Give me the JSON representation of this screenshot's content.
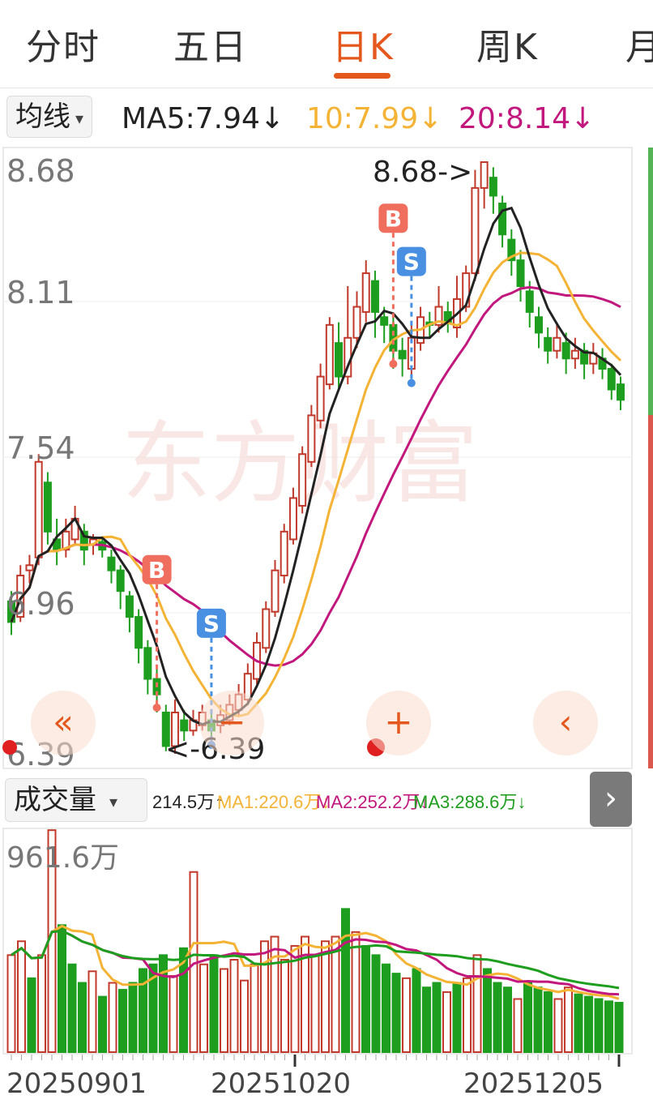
{
  "tabs": [
    {
      "label": "分时",
      "active": false
    },
    {
      "label": "五日",
      "active": false
    },
    {
      "label": "日K",
      "active": true
    },
    {
      "label": "周K",
      "active": false
    },
    {
      "label": "月",
      "active": false
    }
  ],
  "ma_select": {
    "label": "均线",
    "caret": "▾"
  },
  "ma_values": {
    "ma5": "MA5:7.94↓",
    "ma10": "10:7.99↓",
    "ma20": "20:8.14↓"
  },
  "colors": {
    "up": "#c0392b",
    "down": "#1e9e1e",
    "ma5": "#222222",
    "ma10": "#f5b335",
    "ma20": "#c2187e",
    "accent": "#e4571d",
    "buy": "#f06e5e",
    "sell": "#4a90e2"
  },
  "price_axis": {
    "labels": [
      "8.68",
      "8.11",
      "7.54",
      "6.96",
      "6.39"
    ]
  },
  "annotations": {
    "high": "8.68->",
    "low": "<-6.39",
    "buy_label": "B",
    "sell_label": "S"
  },
  "watermark": "东方财富",
  "vol_select": {
    "label": "成交量",
    "caret": "▾"
  },
  "vol_values": {
    "vol": "214.5万↑",
    "ma1": "MA1:220.6万↓",
    "ma2": "MA2:252.2万↓",
    "ma3": "MA3:288.6万↓"
  },
  "vol_axis": {
    "max_label": "961.6万"
  },
  "date_labels": [
    "20250901",
    "20251020",
    "20251205"
  ],
  "controls": {
    "scroll_left": "«",
    "zoom_out": "−",
    "zoom_in": "+",
    "back": "‹",
    "expand": "›"
  },
  "chart_data": {
    "type": "candlestick",
    "ylim": [
      6.39,
      8.68
    ],
    "candles": [
      {
        "o": 6.98,
        "c": 6.9,
        "h": 7.02,
        "l": 6.85
      },
      {
        "o": 6.92,
        "c": 7.08,
        "h": 7.12,
        "l": 6.9
      },
      {
        "o": 7.1,
        "c": 7.12,
        "h": 7.16,
        "l": 7.05
      },
      {
        "o": 7.15,
        "c": 7.52,
        "h": 7.55,
        "l": 7.12
      },
      {
        "o": 7.44,
        "c": 7.25,
        "h": 7.48,
        "l": 7.2
      },
      {
        "o": 7.22,
        "c": 7.18,
        "h": 7.3,
        "l": 7.12
      },
      {
        "o": 7.18,
        "c": 7.25,
        "h": 7.3,
        "l": 7.15
      },
      {
        "o": 7.22,
        "c": 7.3,
        "h": 7.35,
        "l": 7.2
      },
      {
        "o": 7.25,
        "c": 7.18,
        "h": 7.28,
        "l": 7.12
      },
      {
        "o": 7.2,
        "c": 7.22,
        "h": 7.24,
        "l": 7.16
      },
      {
        "o": 7.21,
        "c": 7.18,
        "h": 7.23,
        "l": 7.15
      },
      {
        "o": 7.15,
        "c": 7.1,
        "h": 7.18,
        "l": 7.05
      },
      {
        "o": 7.1,
        "c": 7.02,
        "h": 7.12,
        "l": 6.95
      },
      {
        "o": 7.0,
        "c": 6.92,
        "h": 7.02,
        "l": 6.86
      },
      {
        "o": 6.92,
        "c": 6.8,
        "h": 6.95,
        "l": 6.74
      },
      {
        "o": 6.8,
        "c": 6.68,
        "h": 6.83,
        "l": 6.62
      },
      {
        "o": 6.68,
        "c": 6.62,
        "h": 6.72,
        "l": 6.55
      },
      {
        "o": 6.55,
        "c": 6.42,
        "h": 6.58,
        "l": 6.4
      },
      {
        "o": 6.42,
        "c": 6.55,
        "h": 6.6,
        "l": 6.39
      },
      {
        "o": 6.52,
        "c": 6.48,
        "h": 6.56,
        "l": 6.44
      },
      {
        "o": 6.48,
        "c": 6.52,
        "h": 6.56,
        "l": 6.46
      },
      {
        "o": 6.5,
        "c": 6.55,
        "h": 6.58,
        "l": 6.48
      },
      {
        "o": 6.52,
        "c": 6.48,
        "h": 6.56,
        "l": 6.45
      },
      {
        "o": 6.5,
        "c": 6.54,
        "h": 6.58,
        "l": 6.47
      },
      {
        "o": 6.52,
        "c": 6.58,
        "h": 6.62,
        "l": 6.5
      },
      {
        "o": 6.56,
        "c": 6.62,
        "h": 6.66,
        "l": 6.54
      },
      {
        "o": 6.6,
        "c": 6.7,
        "h": 6.74,
        "l": 6.58
      },
      {
        "o": 6.68,
        "c": 6.82,
        "h": 6.86,
        "l": 6.66
      },
      {
        "o": 6.8,
        "c": 6.95,
        "h": 6.98,
        "l": 6.78
      },
      {
        "o": 6.94,
        "c": 7.1,
        "h": 7.14,
        "l": 6.92
      },
      {
        "o": 7.08,
        "c": 7.25,
        "h": 7.28,
        "l": 7.05
      },
      {
        "o": 7.22,
        "c": 7.38,
        "h": 7.42,
        "l": 7.2
      },
      {
        "o": 7.35,
        "c": 7.55,
        "h": 7.58,
        "l": 7.32
      },
      {
        "o": 7.52,
        "c": 7.7,
        "h": 7.74,
        "l": 7.5
      },
      {
        "o": 7.68,
        "c": 7.85,
        "h": 7.9,
        "l": 7.65
      },
      {
        "o": 7.82,
        "c": 8.05,
        "h": 8.08,
        "l": 7.8
      },
      {
        "o": 7.98,
        "c": 7.85,
        "h": 8.06,
        "l": 7.8
      },
      {
        "o": 7.85,
        "c": 8.0,
        "h": 8.2,
        "l": 7.82
      },
      {
        "o": 8.0,
        "c": 8.12,
        "h": 8.18,
        "l": 7.96
      },
      {
        "o": 8.1,
        "c": 8.25,
        "h": 8.3,
        "l": 8.06
      },
      {
        "o": 8.22,
        "c": 8.1,
        "h": 8.26,
        "l": 8.0
      },
      {
        "o": 8.08,
        "c": 8.05,
        "h": 8.12,
        "l": 7.98
      },
      {
        "o": 8.05,
        "c": 7.95,
        "h": 8.08,
        "l": 7.88
      },
      {
        "o": 7.95,
        "c": 7.92,
        "h": 8.0,
        "l": 7.85
      },
      {
        "o": 7.88,
        "c": 8.0,
        "h": 8.05,
        "l": 7.85
      },
      {
        "o": 7.98,
        "c": 8.08,
        "h": 8.12,
        "l": 7.95
      },
      {
        "o": 8.06,
        "c": 8.05,
        "h": 8.1,
        "l": 8.0
      },
      {
        "o": 8.05,
        "c": 8.12,
        "h": 8.2,
        "l": 8.02
      },
      {
        "o": 8.1,
        "c": 8.06,
        "h": 8.14,
        "l": 8.02
      },
      {
        "o": 8.04,
        "c": 8.15,
        "h": 8.24,
        "l": 8.0
      },
      {
        "o": 8.12,
        "c": 8.25,
        "h": 8.28,
        "l": 8.1
      },
      {
        "o": 8.25,
        "c": 8.58,
        "h": 8.65,
        "l": 8.22
      },
      {
        "o": 8.58,
        "c": 8.68,
        "h": 8.68,
        "l": 8.5
      },
      {
        "o": 8.62,
        "c": 8.55,
        "h": 8.66,
        "l": 8.48
      },
      {
        "o": 8.52,
        "c": 8.4,
        "h": 8.55,
        "l": 8.35
      },
      {
        "o": 8.38,
        "c": 8.3,
        "h": 8.42,
        "l": 8.24
      },
      {
        "o": 8.3,
        "c": 8.2,
        "h": 8.34,
        "l": 8.14
      },
      {
        "o": 8.18,
        "c": 8.1,
        "h": 8.22,
        "l": 8.04
      },
      {
        "o": 8.08,
        "c": 8.02,
        "h": 8.12,
        "l": 7.96
      },
      {
        "o": 8.0,
        "c": 7.95,
        "h": 8.04,
        "l": 7.9
      },
      {
        "o": 7.95,
        "c": 8.0,
        "h": 8.06,
        "l": 7.92
      },
      {
        "o": 7.98,
        "c": 7.92,
        "h": 8.02,
        "l": 7.86
      },
      {
        "o": 7.92,
        "c": 7.95,
        "h": 8.0,
        "l": 7.88
      },
      {
        "o": 7.95,
        "c": 7.9,
        "h": 7.98,
        "l": 7.84
      },
      {
        "o": 7.9,
        "c": 7.94,
        "h": 7.98,
        "l": 7.86
      },
      {
        "o": 7.92,
        "c": 7.88,
        "h": 7.96,
        "l": 7.84
      },
      {
        "o": 7.88,
        "c": 7.8,
        "h": 7.9,
        "l": 7.76
      },
      {
        "o": 7.82,
        "c": 7.76,
        "h": 7.85,
        "l": 7.72
      }
    ],
    "markers": [
      {
        "type": "B",
        "index": 16
      },
      {
        "type": "S",
        "index": 22
      },
      {
        "type": "B",
        "index": 42
      },
      {
        "type": "S",
        "index": 44
      }
    ],
    "volume": {
      "max": 961.6,
      "values": [
        {
          "v": 420,
          "up": true
        },
        {
          "v": 480,
          "up": true
        },
        {
          "v": 320,
          "up": false
        },
        {
          "v": 420,
          "up": true
        },
        {
          "v": 961,
          "up": true
        },
        {
          "v": 550,
          "up": false
        },
        {
          "v": 380,
          "up": false
        },
        {
          "v": 300,
          "up": false
        },
        {
          "v": 350,
          "up": true
        },
        {
          "v": 240,
          "up": false
        },
        {
          "v": 300,
          "up": true
        },
        {
          "v": 270,
          "up": false
        },
        {
          "v": 300,
          "up": false
        },
        {
          "v": 360,
          "up": false
        },
        {
          "v": 380,
          "up": false
        },
        {
          "v": 420,
          "up": false
        },
        {
          "v": 330,
          "up": true
        },
        {
          "v": 450,
          "up": false
        },
        {
          "v": 780,
          "up": true
        },
        {
          "v": 380,
          "up": true
        },
        {
          "v": 420,
          "up": false
        },
        {
          "v": 360,
          "up": true
        },
        {
          "v": 400,
          "up": true
        },
        {
          "v": 310,
          "up": true
        },
        {
          "v": 380,
          "up": true
        },
        {
          "v": 480,
          "up": true
        },
        {
          "v": 500,
          "up": true
        },
        {
          "v": 400,
          "up": true
        },
        {
          "v": 460,
          "up": true
        },
        {
          "v": 500,
          "up": true
        },
        {
          "v": 420,
          "up": true
        },
        {
          "v": 480,
          "up": true
        },
        {
          "v": 500,
          "up": true
        },
        {
          "v": 620,
          "up": false
        },
        {
          "v": 520,
          "up": true
        },
        {
          "v": 460,
          "up": false
        },
        {
          "v": 420,
          "up": false
        },
        {
          "v": 380,
          "up": false
        },
        {
          "v": 340,
          "up": false
        },
        {
          "v": 320,
          "up": true
        },
        {
          "v": 360,
          "up": false
        },
        {
          "v": 280,
          "up": false
        },
        {
          "v": 300,
          "up": false
        },
        {
          "v": 260,
          "up": true
        },
        {
          "v": 300,
          "up": false
        },
        {
          "v": 320,
          "up": true
        },
        {
          "v": 420,
          "up": true
        },
        {
          "v": 360,
          "up": false
        },
        {
          "v": 300,
          "up": false
        },
        {
          "v": 280,
          "up": false
        },
        {
          "v": 230,
          "up": true
        },
        {
          "v": 300,
          "up": false
        },
        {
          "v": 280,
          "up": false
        },
        {
          "v": 260,
          "up": false
        },
        {
          "v": 230,
          "up": true
        },
        {
          "v": 280,
          "up": true
        },
        {
          "v": 250,
          "up": false
        },
        {
          "v": 240,
          "up": false
        },
        {
          "v": 230,
          "up": false
        },
        {
          "v": 220,
          "up": false
        },
        {
          "v": 214,
          "up": false
        }
      ]
    }
  }
}
